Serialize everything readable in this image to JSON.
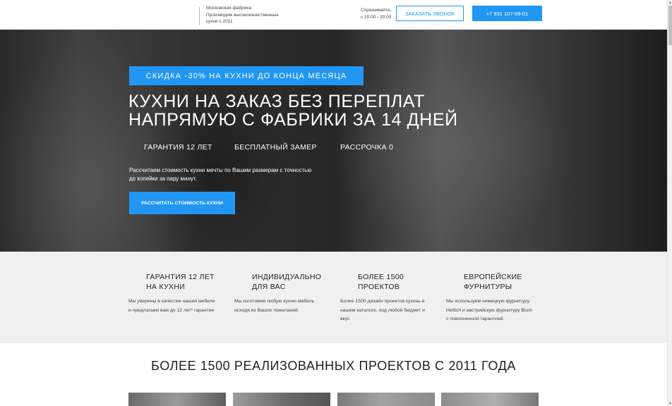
{
  "header": {
    "tagline": [
      "Московская фабрика",
      "Производим высококачественные",
      "кухни с 2011"
    ],
    "hours": [
      "Спрашивайте,",
      "с 10:00 - 20:00"
    ],
    "call_button": "ЗАКАЗАТЬ ЗВОНОК",
    "phone": "+7 931 107-69-01",
    "accent_color": "#2196f3"
  },
  "hero": {
    "promo": "СКИДКА -30% НА КУХНИ ДО КОНЦА МЕСЯЦА",
    "title_lines": [
      "КУХНИ НА ЗАКАЗ БЕЗ ПЕРЕПЛАТ",
      "НАПРЯМУЮ С ФАБРИКИ ЗА 14 ДНЕЙ"
    ],
    "features": [
      "ГАРАНТИЯ 12 ЛЕТ",
      "БЕСПЛАТНЫЙ ЗАМЕР",
      "РАССРОЧКА 0"
    ],
    "description_lines": [
      "Рассчитаем стоимость кухни мечты по Вашим размерам с точностью",
      "до копейки за пару минут."
    ],
    "cta": "РАССЧИТАТЬ СТОИМОСТЬ КУХНИ"
  },
  "benefits": [
    {
      "title_lines": [
        "ГАРАНТИЯ 12 ЛЕТ",
        "НА КУХНИ"
      ],
      "text_lines": [
        "Мы уверены в качестве нашей мебели",
        "и предлагаем вам до 12 лет* гарантии"
      ]
    },
    {
      "title_lines": [
        "ИНДИВИДУАЛЬНО",
        "ДЛЯ ВАС"
      ],
      "text_lines": [
        "Мы изготовим любую кухню мебель",
        "исходя из Ваших пожеланий"
      ]
    },
    {
      "title_lines": [
        "БОЛЕЕ 1500",
        "ПРОЕКТОВ"
      ],
      "text_lines": [
        "Более 1500 дизайн проектов кухонь в",
        "нашем каталоге, под любой бюджет и",
        "вкус"
      ]
    },
    {
      "title_lines": [
        "ЕВРОПЕЙСКИЕ",
        "ФУРНИТУРЫ"
      ],
      "text_lines": [
        "Мы используем немецкую фурнитуру",
        "Hettich и австрийскую фурнитуру Blum",
        "с пожизненной гарантией."
      ]
    }
  ],
  "projects": {
    "title": "БОЛЕЕ 1500 РЕАЛИЗОВАННЫХ ПРОЕКТОВ С 2011 ГОДА"
  }
}
